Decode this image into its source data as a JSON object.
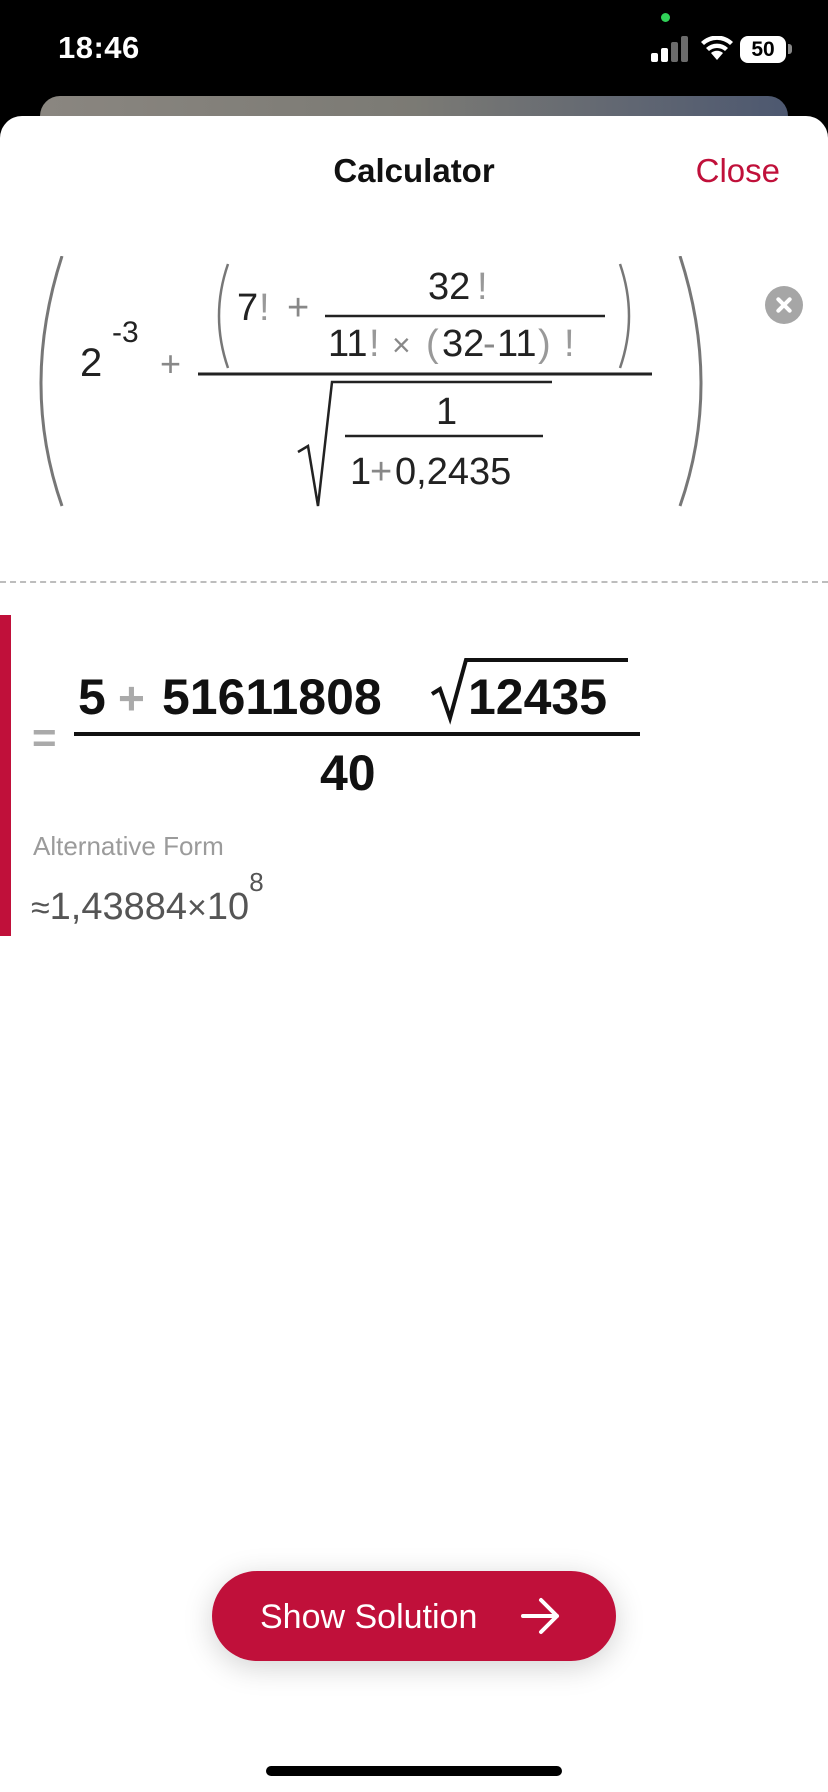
{
  "status": {
    "time": "18:46",
    "battery": "50"
  },
  "header": {
    "title": "Calculator",
    "close_label": "Close"
  },
  "expression": {
    "base": "2",
    "exponent": "-3",
    "plus": "+",
    "num_left": "7",
    "factorial": "!",
    "frac_num": "32",
    "frac_den_a": "11",
    "times": "×",
    "paren_open": "(",
    "frac_den_b": "32",
    "minus": "-",
    "frac_den_c": "11",
    "paren_close": ")",
    "root_num": "1",
    "root_den_one": "1",
    "root_den_val": "0,2435"
  },
  "result": {
    "equals": "=",
    "numerator_a": "5",
    "plus": "+",
    "numerator_b": "51611808",
    "radicand": "12435",
    "denominator": "40"
  },
  "alternative": {
    "label": "Alternative Form",
    "approx": "≈",
    "mantissa": "1,43884",
    "times": "×",
    "base": "10",
    "exponent": "8"
  },
  "actions": {
    "show_solution_label": "Show Solution"
  },
  "colors": {
    "accent": "#c0103a",
    "status_dot": "#30d158"
  },
  "icons": {
    "clear": "clear-circle-icon",
    "arrow": "arrow-right-icon"
  }
}
